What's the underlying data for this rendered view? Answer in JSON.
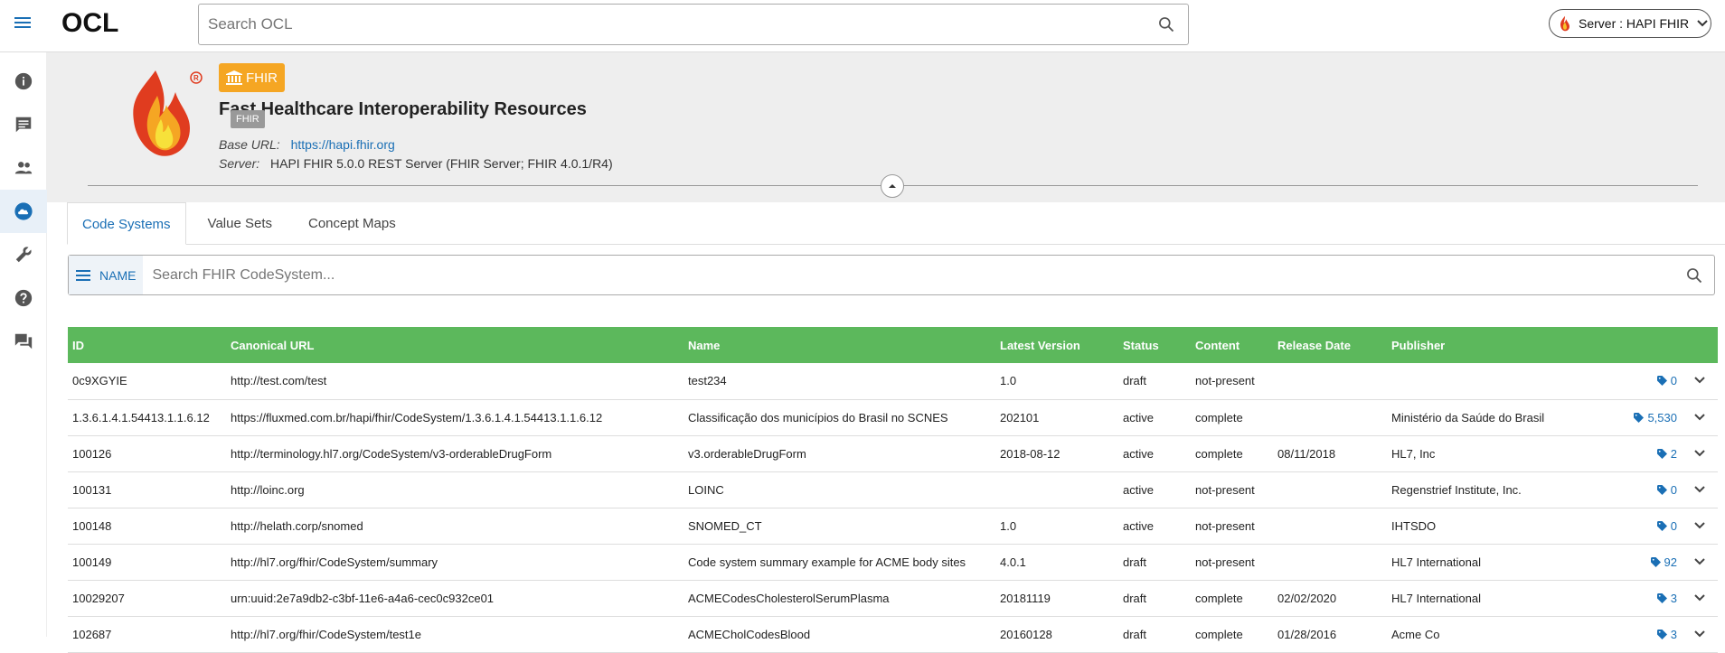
{
  "app": {
    "title": "OCL"
  },
  "search": {
    "placeholder": "Search OCL"
  },
  "server": {
    "label": "Server : HAPI FHIR"
  },
  "sidebar": {
    "items": [
      "info-icon",
      "chat-icon",
      "people-icon",
      "cloud-icon",
      "wrench-icon",
      "help-icon",
      "forum-icon"
    ],
    "active": 3
  },
  "header": {
    "badge": "FHIR",
    "title": "Fast Healthcare Interoperability Resources",
    "tag": "FHIR",
    "base_url_label": "Base URL:",
    "base_url": "https://hapi.fhir.org",
    "server_label": "Server:",
    "server_value": "HAPI FHIR 5.0.0 REST Server (FHIR Server; FHIR 4.0.1/R4)"
  },
  "tabs": [
    "Code Systems",
    "Value Sets",
    "Concept Maps"
  ],
  "filter": {
    "field": "NAME",
    "placeholder": "Search FHIR CodeSystem..."
  },
  "table": {
    "columns": [
      "ID",
      "Canonical URL",
      "Name",
      "Latest Version",
      "Status",
      "Content",
      "Release Date",
      "Publisher"
    ],
    "rows": [
      {
        "id": "0c9XGYIE",
        "url": "http://test.com/test",
        "name": "test234",
        "version": "1.0",
        "status": "draft",
        "content": "not-present",
        "date": "",
        "publisher": "",
        "count": "0"
      },
      {
        "id": "1.3.6.1.4.1.54413.1.1.6.12",
        "url": "https://fluxmed.com.br/hapi/fhir/CodeSystem/1.3.6.1.4.1.54413.1.1.6.12",
        "name": "Classificação dos municípios do Brasil no SCNES",
        "version": "202101",
        "status": "active",
        "content": "complete",
        "date": "",
        "publisher": "Ministério da Saúde do Brasil",
        "count": "5,530"
      },
      {
        "id": "100126",
        "url": "http://terminology.hl7.org/CodeSystem/v3-orderableDrugForm",
        "name": "v3.orderableDrugForm",
        "version": "2018-08-12",
        "status": "active",
        "content": "complete",
        "date": "08/11/2018",
        "publisher": "HL7, Inc",
        "count": "2"
      },
      {
        "id": "100131",
        "url": "http://loinc.org",
        "name": "LOINC",
        "version": "",
        "status": "active",
        "content": "not-present",
        "date": "",
        "publisher": "Regenstrief Institute, Inc.",
        "count": "0"
      },
      {
        "id": "100148",
        "url": "http://helath.corp/snomed",
        "name": "SNOMED_CT",
        "version": "1.0",
        "status": "active",
        "content": "not-present",
        "date": "",
        "publisher": "IHTSDO",
        "count": "0"
      },
      {
        "id": "100149",
        "url": "http://hl7.org/fhir/CodeSystem/summary",
        "name": "Code system summary example for ACME body sites",
        "version": "4.0.1",
        "status": "draft",
        "content": "not-present",
        "date": "",
        "publisher": "HL7 International",
        "count": "92"
      },
      {
        "id": "10029207",
        "url": "urn:uuid:2e7a9db2-c3bf-11e6-a4a6-cec0c932ce01",
        "name": "ACMECodesCholesterolSerumPlasma",
        "version": "20181119",
        "status": "draft",
        "content": "complete",
        "date": "02/02/2020",
        "publisher": "HL7 International",
        "count": "3"
      },
      {
        "id": "102687",
        "url": "http://hl7.org/fhir/CodeSystem/test1e",
        "name": "ACMECholCodesBlood",
        "version": "20160128",
        "status": "draft",
        "content": "complete",
        "date": "01/28/2016",
        "publisher": "Acme Co",
        "count": "3"
      }
    ]
  },
  "colors": {
    "accent": "#1a6fb5",
    "header_green": "#5cb85c",
    "badge_orange": "#f5a623"
  }
}
